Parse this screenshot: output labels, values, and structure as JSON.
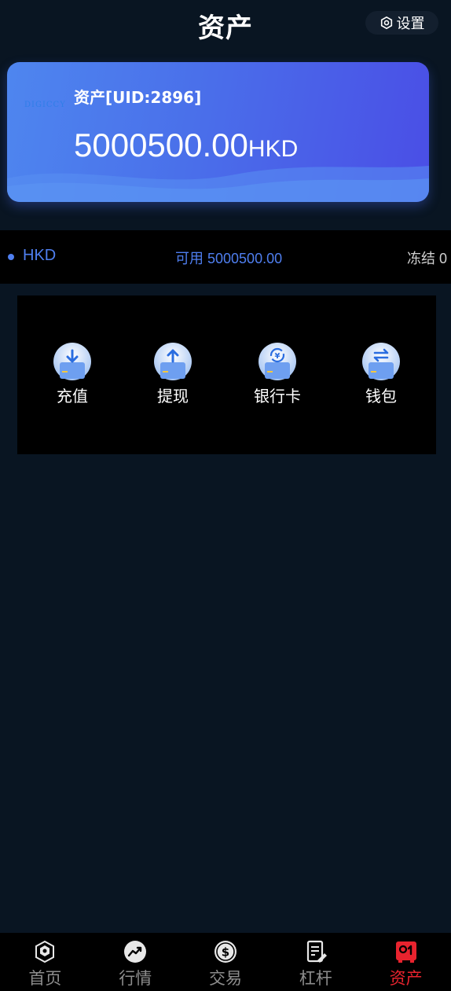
{
  "header": {
    "title": "资产",
    "settings_label": "设置"
  },
  "card": {
    "logo_text": "DIGICCY",
    "uid_label": "资产[UID:2896]",
    "amount": "5000500.00",
    "currency": "HKD"
  },
  "balance": {
    "currency": "HKD",
    "available": "可用 5000500.00",
    "frozen": "冻结 0"
  },
  "actions": [
    {
      "label": "充值",
      "icon": "deposit-icon"
    },
    {
      "label": "提现",
      "icon": "withdraw-icon"
    },
    {
      "label": "银行卡",
      "icon": "bank-card-icon"
    },
    {
      "label": "钱包",
      "icon": "wallet-icon"
    }
  ],
  "tabbar": {
    "items": [
      {
        "label": "首页",
        "icon": "home-icon"
      },
      {
        "label": "行情",
        "icon": "market-icon"
      },
      {
        "label": "交易",
        "icon": "trade-icon"
      },
      {
        "label": "杠杆",
        "icon": "leverage-icon"
      },
      {
        "label": "资产",
        "icon": "assets-icon",
        "active": true
      }
    ]
  },
  "colors": {
    "background": "#091522",
    "accent": "#4f7ff0",
    "active_tab": "#e8232e"
  }
}
